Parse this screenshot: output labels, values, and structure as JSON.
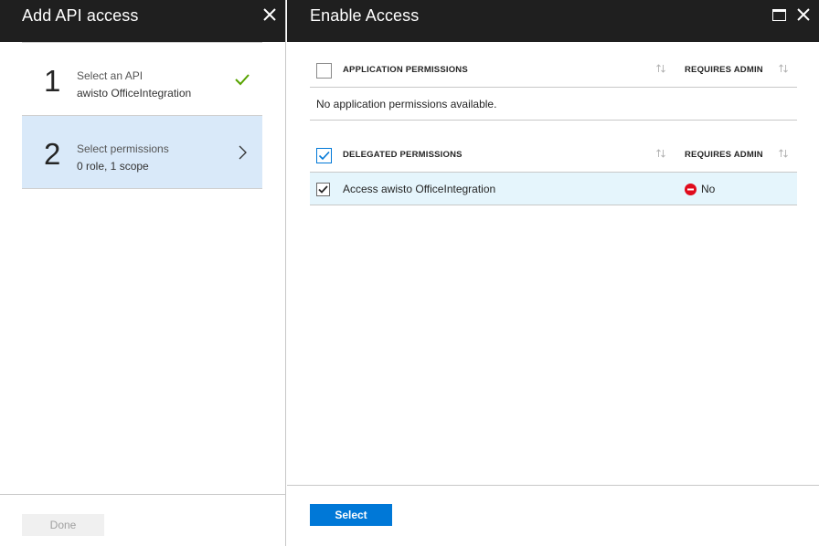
{
  "left_blade": {
    "title": "Add API access",
    "steps": [
      {
        "number": "1",
        "title": "Select an API",
        "subtitle": "awisto OfficeIntegration",
        "state": "complete",
        "status_icon": "check-icon"
      },
      {
        "number": "2",
        "title": "Select permissions",
        "subtitle": "0 role, 1 scope",
        "state": "active",
        "status_icon": "chevron-right-icon"
      }
    ],
    "done_label": "Done"
  },
  "right_blade": {
    "title": "Enable Access",
    "application_permissions": {
      "header": "APPLICATION PERMISSIONS",
      "admin_header": "REQUIRES ADMIN",
      "checked": false,
      "empty_message": "No application permissions available."
    },
    "delegated_permissions": {
      "header": "DELEGATED PERMISSIONS",
      "admin_header": "REQUIRES ADMIN",
      "checked": true,
      "rows": [
        {
          "label": "Access awisto OfficeIntegration",
          "checked": true,
          "requires_admin": "No"
        }
      ]
    },
    "select_label": "Select"
  },
  "colors": {
    "header_bg": "#1f1f1f",
    "accent": "#0078d7",
    "active_step_bg": "#d9e9f9",
    "selected_row_bg": "#e5f5fc",
    "check_green": "#57a300",
    "no_red": "#e00b1c"
  }
}
